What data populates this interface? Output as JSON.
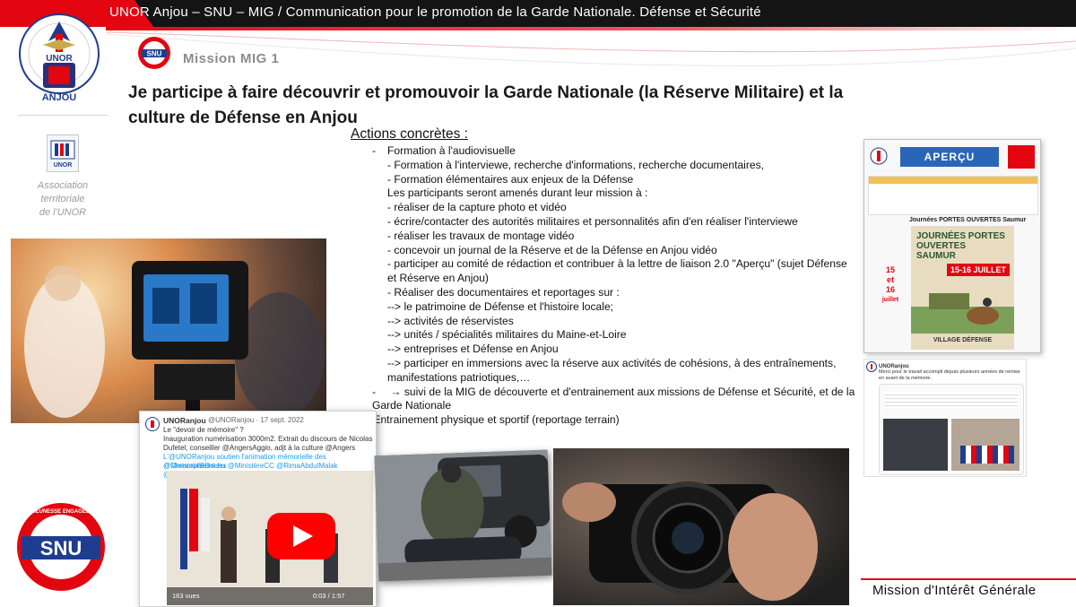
{
  "header": {
    "title": "UNOR Anjou – SNU – MIG  / Communication pour le promotion de la Garde Nationale. Défense et Sécurité"
  },
  "colors": {
    "accent_red": "#e3050f",
    "header_black": "#141414",
    "snu_blue": "#1f3d8f"
  },
  "logos": {
    "unor_top": "UNOR",
    "unor_bottom": "ANJOU",
    "unor_ring": "UNION NATIONALE des ORGANISATIONS de RÉSERVE",
    "assoc_logo": "UNOR",
    "assoc_text": [
      "Association",
      "territoriale",
      "de l'UNOR"
    ],
    "snu_small": "SNU",
    "snu_big": "SNU",
    "snu_ring": "JEUNESSE ENGAGÉE"
  },
  "mission_label": "Mission  MIG 1",
  "main_title": "Je participe à faire découvrir et promouvoir la Garde Nationale (la Réserve Militaire) et la culture de Défense en Anjou",
  "actions": {
    "heading": "Actions concrètes :",
    "lines": [
      "Formation à l'audiovisuelle",
      "- Formation à l'interviewe, recherche d'informations, recherche documentaires,",
      "- Formation élémentaires aux enjeux de la Défense",
      "Les participants seront amenés durant leur mission à :",
      "- réaliser de la capture photo et vidéo",
      "- écrire/contacter des autorités militaires et personnalités afin d'en réaliser l'interviewe",
      "- réaliser les travaux de montage vidéo",
      "- concevoir un journal de la Réserve et de la Défense en Anjou vidéo",
      "- participer au comité de rédaction et contribuer à la lettre de liaison 2.0 \"Aperçu\" (sujet Défense et Réserve en Anjou)",
      "- Réaliser des documentaires et reportages sur :",
      "--> le patrimoine de Défense et l'histoire locale;",
      "--> activités de réservistes",
      "--> unités / spécialités militaires du Maine-et-Loire",
      "--> entreprises et Défense en Anjou",
      "--> participer en immersions avec la réserve aux activités de cohésions, à des entraînements, manifestations patriotiques,…",
      "suivi de la MIG de découverte et d'entrainement aux missions de Défense et Sécurité, et de la Garde Nationale",
      "Entrainement physique et sportif (reportage terrain)"
    ]
  },
  "tweet": {
    "author": "UNORanjou",
    "handle": "@UNORanjou · 17 sept. 2022",
    "line1": "Le \"devoir de mémoire\" ?",
    "line2": "Inauguration numérisation 3000m2. Extrait du discours de Nicolas",
    "line3": "Dufetel, conseiller @AngersAggio, adjt à la culture @Angers",
    "line4": "L'@UNORanjou soutien l'animation mémorielle des @MemorialBunkers",
    "line5": "@ChristopheBechu @MinistèreCC @RimaAbdulMalak @UNORanjou",
    "views": "163 vues",
    "time": "0:03 / 1:57"
  },
  "newsletter": {
    "banner": "APERÇU",
    "event": "Journées PORTES OUVERTES Saumur",
    "poster_title": "JOURNÉES PORTES OUVERTES SAUMUR",
    "poster_dates": "15-16 JUILLET",
    "day_label_1": "15",
    "day_label_2": "et",
    "day_label_3": "16",
    "day_label_4": "juillet",
    "village": "VILLAGE DÉFENSE"
  },
  "tweet2": {
    "author": "UNORanjou",
    "text": "Merci pour le travail accompli depuis plusieurs années de remise en avant de la mémoire."
  },
  "footer": {
    "text": "Mission d'Intérêt Générale"
  },
  "icons": {
    "play": "play-icon",
    "arrow": "right-arrow-icon"
  }
}
